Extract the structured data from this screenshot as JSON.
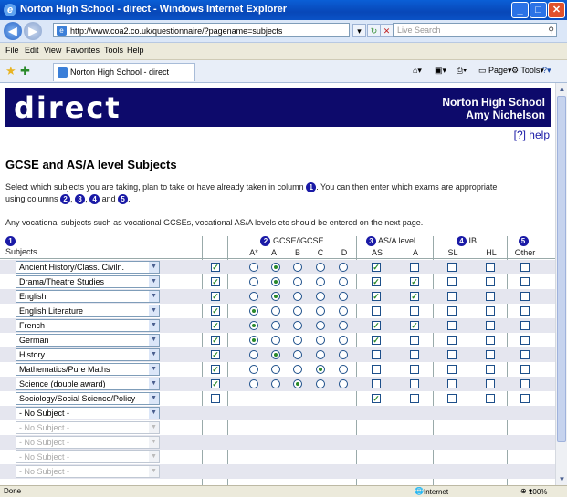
{
  "window": {
    "title": "Norton High School - direct - Windows Internet Explorer",
    "minimize": "_",
    "maximize": "□",
    "close": "✕"
  },
  "address": {
    "url": "http://www.coa2.co.uk/questionnaire/?pagename=subjects",
    "search_placeholder": "Live Search"
  },
  "menu": [
    "File",
    "Edit",
    "View",
    "Favorites",
    "Tools",
    "Help"
  ],
  "tabbar": {
    "tab_title": "Norton High School - direct",
    "page_label": "Page",
    "tools_label": "Tools"
  },
  "page": {
    "logo": "direct",
    "school": "Norton High School",
    "student": "Amy Nichelson",
    "help": "[?] help",
    "heading": "GCSE and AS/A level Subjects",
    "intro_1": "Select which subjects you are taking, plan to take or have already taken in column",
    "intro_2": ". You can then enter which exams are appropriate",
    "intro_3": "using columns",
    "intro_and": "and",
    "note": "Any vocational subjects such as vocational GCSEs, vocational AS/A levels etc should be entered on the next page."
  },
  "columns": {
    "n1": "1",
    "n2": "2",
    "n3": "3",
    "n4": "4",
    "n5": "5",
    "subjects": "Subjects",
    "gcse": "GCSE/iGCSE",
    "as_a": "AS/A level",
    "ib": "IB",
    "other": "Other",
    "grades": [
      "A*",
      "A",
      "B",
      "C",
      "D"
    ],
    "as_labels": [
      "AS",
      "A"
    ],
    "ib_labels": [
      "SL",
      "HL"
    ]
  },
  "rows": [
    {
      "subject": "Ancient History/Class. Civiln.",
      "sel": true,
      "grade": 1,
      "as": true,
      "a": false
    },
    {
      "subject": "Drama/Theatre Studies",
      "sel": true,
      "grade": 1,
      "as": true,
      "a": true
    },
    {
      "subject": "English",
      "sel": true,
      "grade": 1,
      "as": true,
      "a": true
    },
    {
      "subject": "English Literature",
      "sel": true,
      "grade": 0,
      "as": false,
      "a": false
    },
    {
      "subject": "French",
      "sel": true,
      "grade": 0,
      "as": true,
      "a": true
    },
    {
      "subject": "German",
      "sel": true,
      "grade": 0,
      "as": true,
      "a": false
    },
    {
      "subject": "History",
      "sel": true,
      "grade": 1,
      "as": false,
      "a": false
    },
    {
      "subject": "Mathematics/Pure Maths",
      "sel": true,
      "grade": 3,
      "as": false,
      "a": false
    },
    {
      "subject": "Science (double award)",
      "sel": true,
      "grade": 2,
      "as": false,
      "a": false
    },
    {
      "subject": "Sociology/Social Science/Policy",
      "sel": false,
      "grade": -1,
      "as": true,
      "a": false
    },
    {
      "subject": "- No Subject -",
      "sel": false,
      "grade": -2,
      "as": false,
      "a": false,
      "empty": true
    },
    {
      "subject": "- No Subject -",
      "sel": false,
      "grade": -2,
      "as": false,
      "a": false,
      "empty": true,
      "disabled": true
    },
    {
      "subject": "- No Subject -",
      "sel": false,
      "grade": -2,
      "as": false,
      "a": false,
      "empty": true,
      "disabled": true
    },
    {
      "subject": "- No Subject -",
      "sel": false,
      "grade": -2,
      "as": false,
      "a": false,
      "empty": true,
      "disabled": true
    },
    {
      "subject": "- No Subject -",
      "sel": false,
      "grade": -2,
      "as": false,
      "a": false,
      "empty": true,
      "disabled": true
    }
  ],
  "status": {
    "left": "Done",
    "zone": "Internet",
    "zoom": "100%"
  }
}
